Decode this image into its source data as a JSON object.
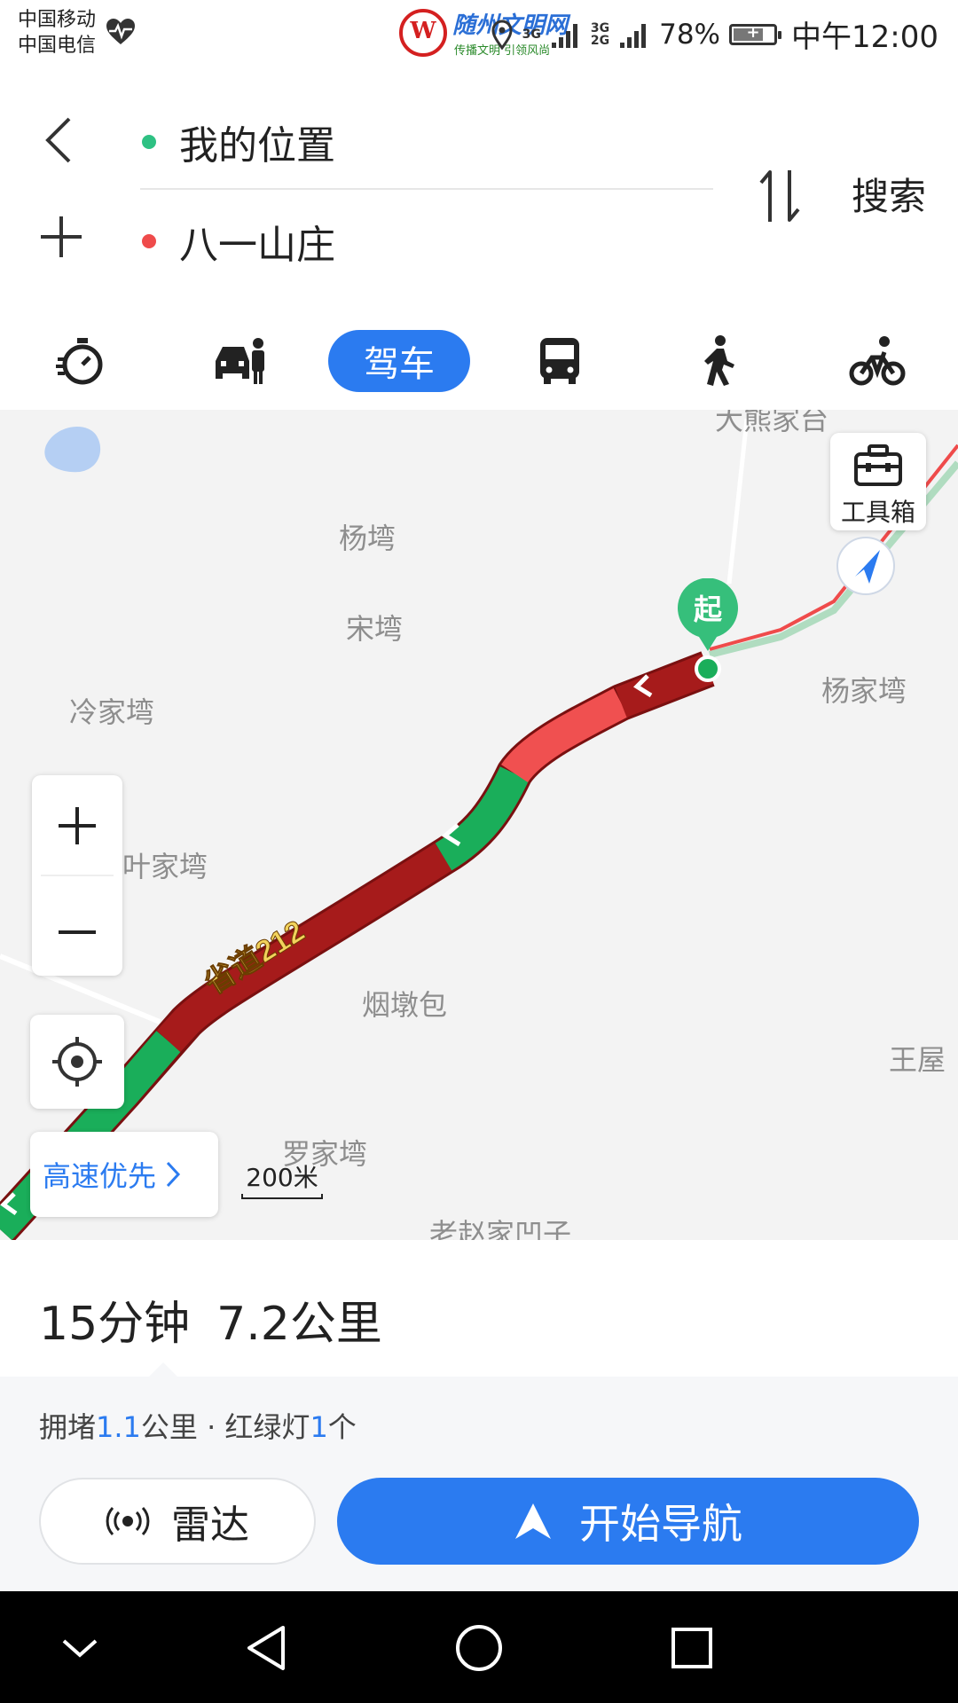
{
  "status_bar": {
    "carrier_1": "中国移动",
    "carrier_2": "中国电信",
    "logo_mark": "W",
    "logo_title": "随州文明网",
    "logo_subtitle": "传播文明  引领风尚",
    "network_1": "3G",
    "network_2": "2G",
    "battery": "78%",
    "battery_level": 0.78,
    "time": "中午12:00"
  },
  "route": {
    "origin": "我的位置",
    "destination": "八一山庄",
    "search_label": "搜索"
  },
  "modes": {
    "active_label": "驾车",
    "icons": [
      "timer-icon",
      "car-person-icon",
      "bus-icon",
      "walk-icon",
      "bike-icon"
    ]
  },
  "map": {
    "toolbox_label": "工具箱",
    "start_label": "起",
    "route_pref": "高速优先",
    "scale": "200米",
    "road_label": "省道212",
    "places": [
      "大熊家台",
      "杨塆",
      "宋塆",
      "冷家塆",
      "杨家塆",
      "叶家塆",
      "烟墩包",
      "王屋",
      "罗家塆",
      "老赵家凹子"
    ],
    "colors": {
      "congested": "#a61b1b",
      "slow": "#f05050",
      "clear": "#1aae5a"
    }
  },
  "summary": {
    "duration": "15分钟",
    "distance": "7.2公里",
    "detail_prefix": "拥堵",
    "congestion": "1.1",
    "detail_mid": "公里 · 红绿灯",
    "lights": "1",
    "detail_suffix": "个"
  },
  "actions": {
    "radar": "雷达",
    "start_nav": "开始导航"
  },
  "colors": {
    "accent": "#2b7bf0"
  }
}
